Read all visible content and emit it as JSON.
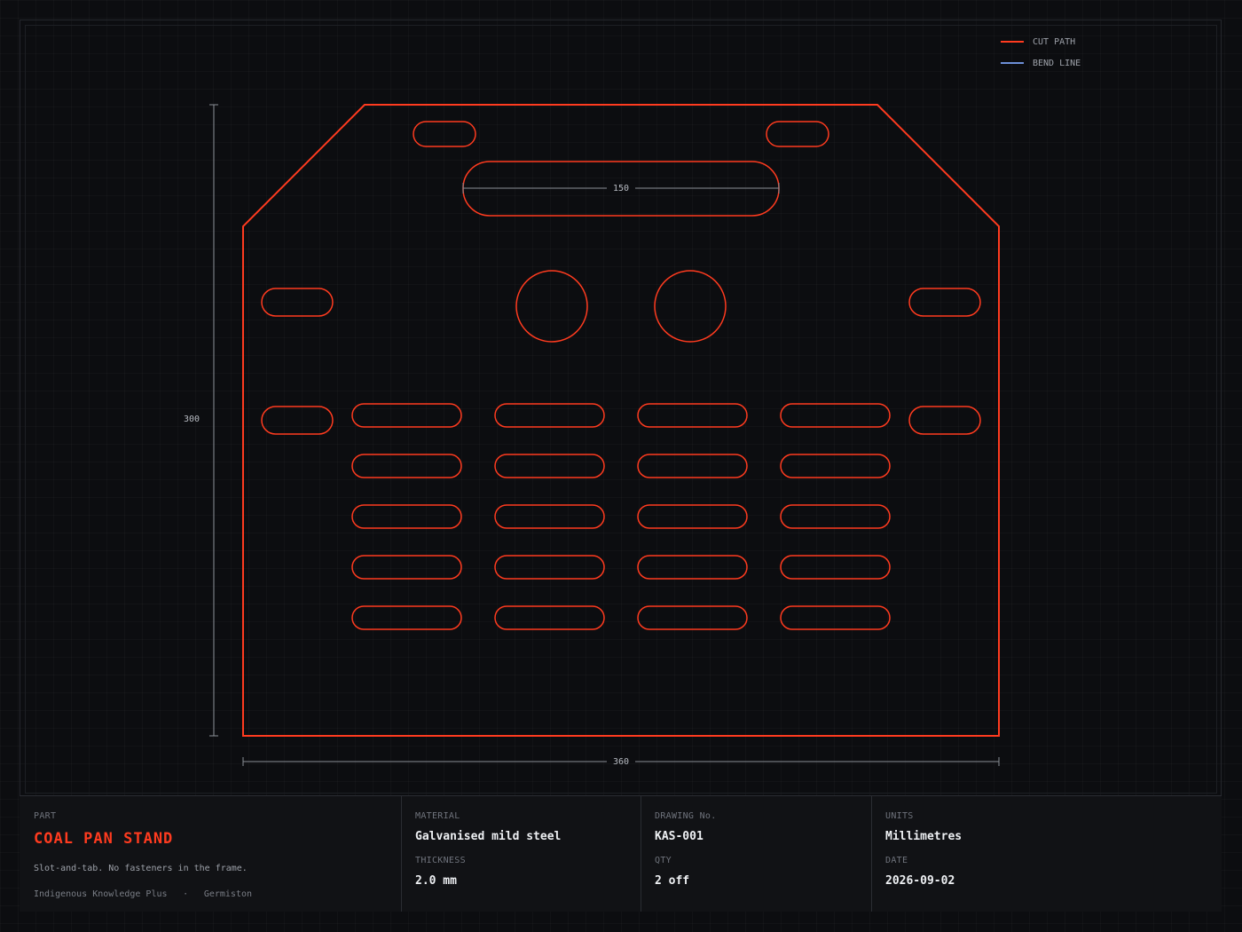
{
  "legend": {
    "cut_label": "CUT PATH",
    "bend_label": "BEND LINE",
    "cut_color": "#ff3b1f",
    "bend_color": "#6d8fd8"
  },
  "dimensions": {
    "width": "360",
    "height": "300",
    "slot_width": "150"
  },
  "title_block": {
    "part_label": "PART",
    "part_name": "COAL PAN STAND",
    "description": "Slot-and-tab. No fasteners in the frame.",
    "company": "Indigenous Knowledge Plus",
    "separator": "·",
    "location": "Germiston",
    "material_label": "MATERIAL",
    "material": "Galvanised mild steel",
    "thickness_label": "THICKNESS",
    "thickness": "2.0 mm",
    "drawing_no_label": "DRAWING No.",
    "drawing_no": "KAS-001",
    "qty_label": "QTY",
    "qty": "2 off",
    "units_label": "UNITS",
    "units": "Millimetres",
    "date_label": "DATE",
    "date": "2026-09-02"
  }
}
